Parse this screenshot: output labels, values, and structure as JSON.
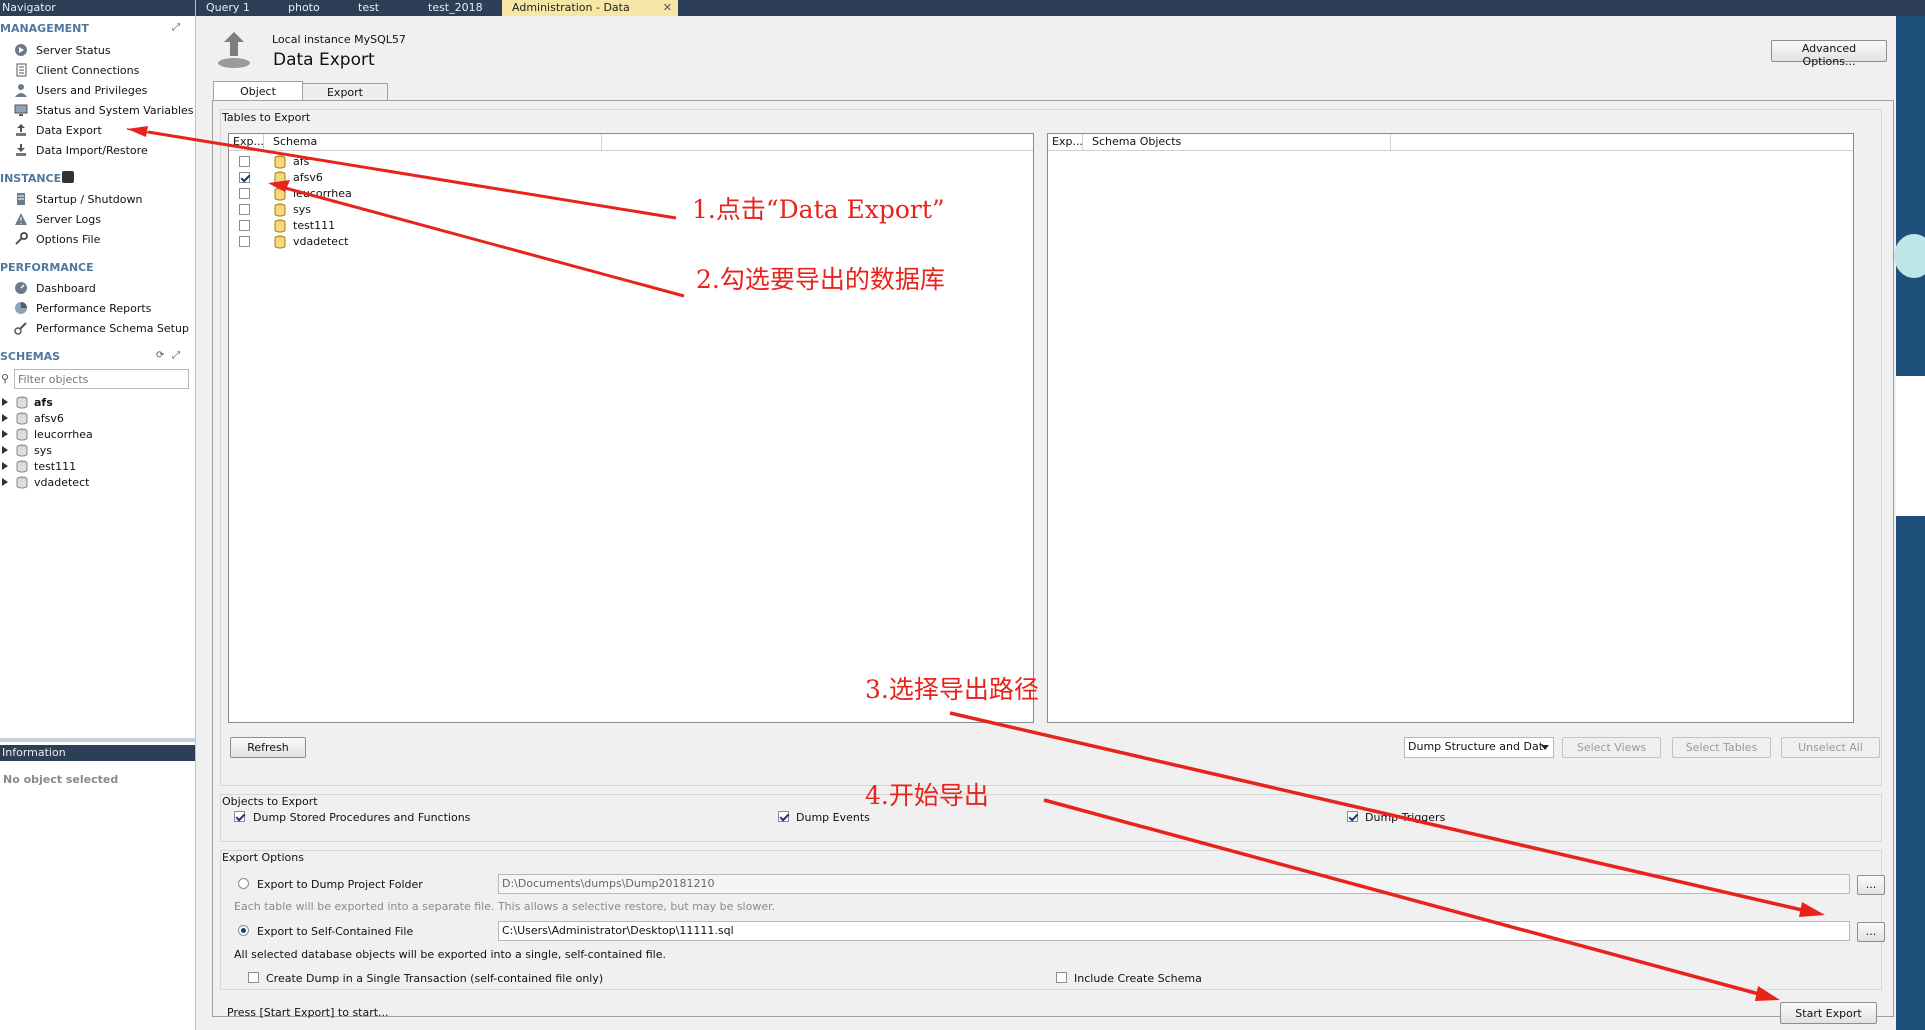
{
  "navigator": {
    "title": "Navigator",
    "management": {
      "title": "MANAGEMENT",
      "items": [
        "Server Status",
        "Client Connections",
        "Users and Privileges",
        "Status and System Variables",
        "Data Export",
        "Data Import/Restore"
      ]
    },
    "instance": {
      "title": "INSTANCE",
      "items": [
        "Startup / Shutdown",
        "Server Logs",
        "Options File"
      ]
    },
    "performance": {
      "title": "PERFORMANCE",
      "items": [
        "Dashboard",
        "Performance Reports",
        "Performance Schema Setup"
      ]
    },
    "schemas": {
      "title": "SCHEMAS",
      "filter_placeholder": "Filter objects",
      "items": [
        "afs",
        "afsv6",
        "leucorrhea",
        "sys",
        "test111",
        "vdadetect"
      ]
    }
  },
  "information": {
    "title": "Information",
    "text": "No object selected"
  },
  "tabs": [
    "Query 1",
    "photo",
    "test",
    "test_2018",
    "Administration - Data Export"
  ],
  "header": {
    "instance": "Local instance MySQL57",
    "title": "Data Export",
    "advanced_button": "Advanced Options..."
  },
  "subtabs": [
    "Object Selection",
    "Export Progress"
  ],
  "tables_to_export": {
    "title": "Tables to Export",
    "left_columns": [
      "Exp...",
      "Schema"
    ],
    "right_columns": [
      "Exp...",
      "Schema Objects"
    ],
    "schemas": [
      {
        "name": "afs",
        "checked": false
      },
      {
        "name": "afsv6",
        "checked": true
      },
      {
        "name": "leucorrhea",
        "checked": false
      },
      {
        "name": "sys",
        "checked": false
      },
      {
        "name": "test111",
        "checked": false
      },
      {
        "name": "vdadetect",
        "checked": false
      }
    ],
    "refresh_button": "Refresh",
    "dump_select": "Dump Structure and Dat",
    "select_views": "Select Views",
    "select_tables": "Select Tables",
    "unselect_all": "Unselect All"
  },
  "objects_to_export": {
    "title": "Objects to Export",
    "dump_routines": "Dump Stored Procedures and Functions",
    "dump_events": "Dump Events",
    "dump_triggers": "Dump Triggers"
  },
  "export_options": {
    "title": "Export Options",
    "folder_label": "Export to Dump Project Folder",
    "folder_path": "D:\\Documents\\dumps\\Dump20181210",
    "folder_note": "Each table will be exported into a separate file. This allows a selective restore, but may be slower.",
    "file_label": "Export to Self-Contained File",
    "file_path": "C:\\Users\\Administrator\\Desktop\\11111.sql",
    "file_note": "All selected database objects will be exported into a single, self-contained file.",
    "browse": "...",
    "single_transaction": "Create Dump in a Single Transaction (self-contained file only)",
    "include_schema": "Include Create Schema"
  },
  "status_text": "Press [Start Export] to start...",
  "start_button": "Start Export",
  "annotations": [
    "1.点击“Data Export”",
    "2.勾选要导出的数据库",
    "3.选择导出路径",
    "4.开始导出"
  ],
  "colors": {
    "annotation": "#e8231c",
    "header_bar": "#2c3f56",
    "active_tab": "#f6e7a6",
    "section_title": "#4e78a0"
  }
}
